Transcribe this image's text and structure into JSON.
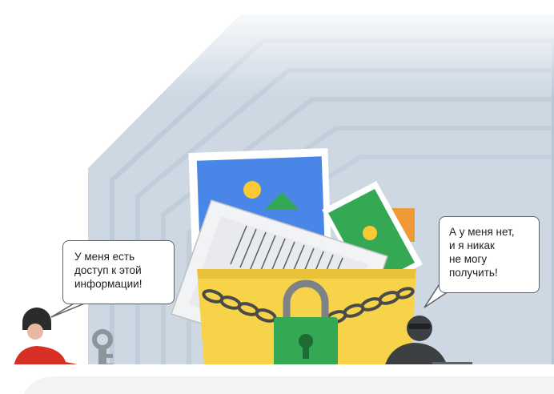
{
  "bubbles": {
    "left": [
      "У меня есть",
      "доступ к этой",
      "информации!"
    ],
    "right": [
      "А у меня нет,",
      "и я никак",
      "не могу",
      "получить!"
    ]
  },
  "colors": {
    "shield": "#c9d5e1",
    "shield_rings": "#b5c3d1",
    "photo_blue": "#4a86e8",
    "photo_green": "#34a853",
    "photo_orange": "#f09a37",
    "sun_yellow": "#fbc933",
    "folder_yellow": "#f7d34a",
    "lock_green": "#34a853",
    "chain_grey": "#555555",
    "woman_red": "#d93025",
    "key_grey": "#8d959c",
    "hacker_dark": "#3c4043"
  },
  "icons": [
    "shield-icon",
    "photo-icon",
    "document-icon",
    "folder-icon",
    "chain-icon",
    "padlock-icon",
    "key-icon",
    "person-icon",
    "hacker-icon"
  ]
}
